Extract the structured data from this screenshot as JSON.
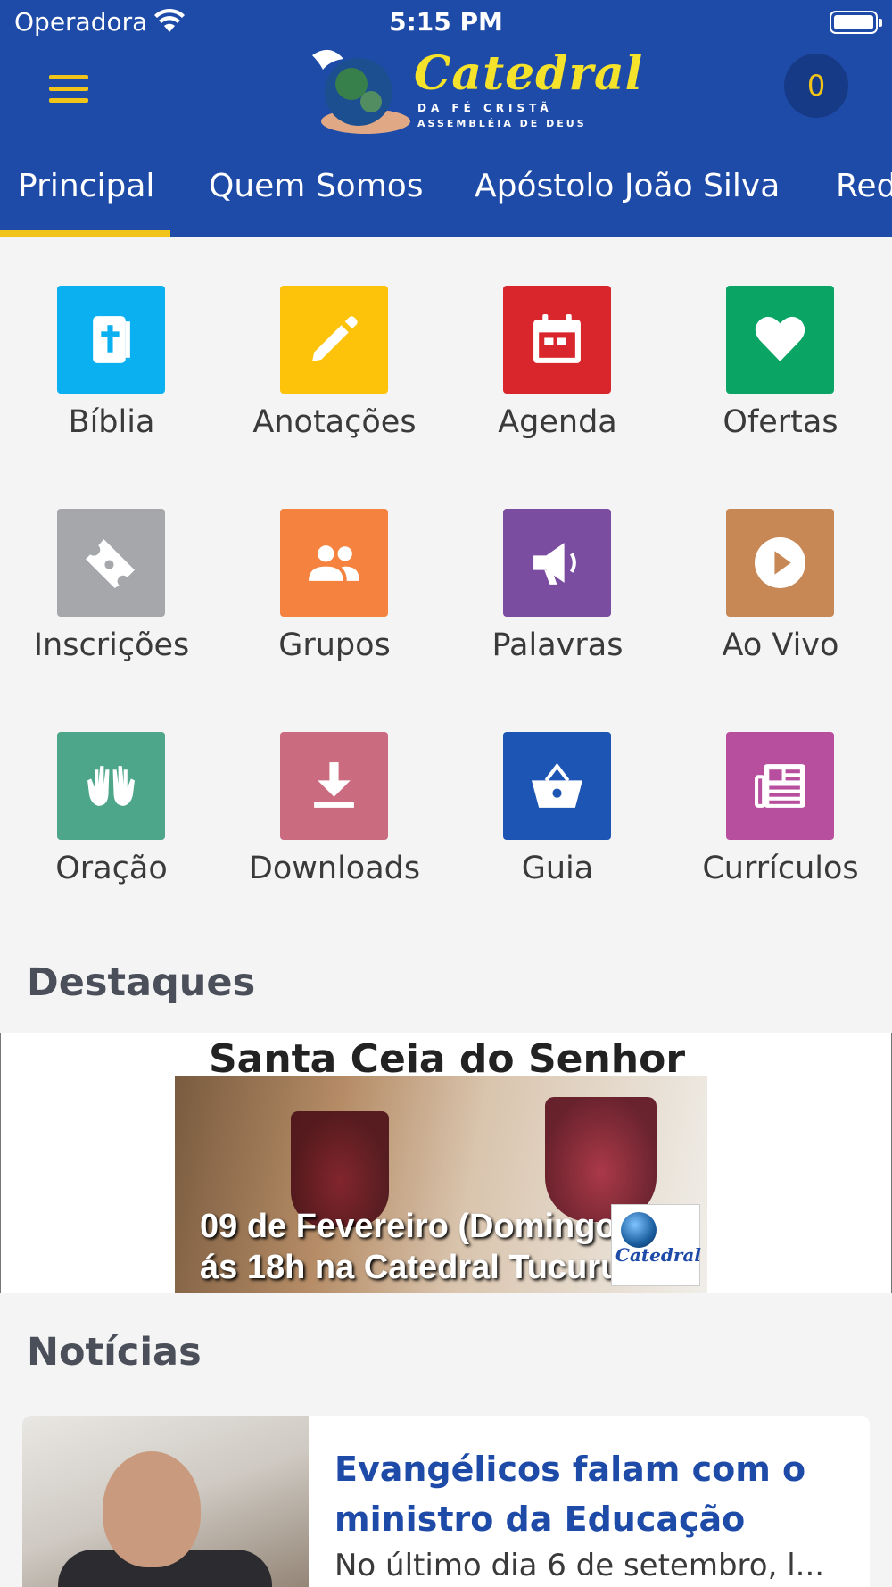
{
  "status_bar": {
    "carrier": "Operadora",
    "time": "5:15 PM"
  },
  "header": {
    "logo_text": "Catedral",
    "logo_sub1": "DA FÉ CRISTÃ",
    "logo_sub2": "ASSEMBLÉIA DE DEUS",
    "cart_count": "0"
  },
  "tabs": [
    {
      "label": "Principal",
      "active": true
    },
    {
      "label": "Quem Somos"
    },
    {
      "label": "Apóstolo João Silva"
    },
    {
      "label": "Red"
    }
  ],
  "tiles": [
    {
      "label": "Bíblia",
      "color": "#0ab0ef",
      "icon": "bible-icon"
    },
    {
      "label": "Anotações",
      "color": "#fdc30b",
      "icon": "pencil-icon"
    },
    {
      "label": "Agenda",
      "color": "#d9262c",
      "icon": "calendar-icon"
    },
    {
      "label": "Ofertas",
      "color": "#0aa564",
      "icon": "heart-icon"
    },
    {
      "label": "Inscrições",
      "color": "#a5a7aa",
      "icon": "ticket-icon"
    },
    {
      "label": "Grupos",
      "color": "#f5833f",
      "icon": "users-icon"
    },
    {
      "label": "Palavras",
      "color": "#7b4da0",
      "icon": "megaphone-icon"
    },
    {
      "label": "Ao Vivo",
      "color": "#c78856",
      "icon": "play-icon"
    },
    {
      "label": "Oração",
      "color": "#4da68a",
      "icon": "praying-hands-icon"
    },
    {
      "label": "Downloads",
      "color": "#cb6b80",
      "icon": "download-icon"
    },
    {
      "label": "Guia",
      "color": "#1d55b4",
      "icon": "basket-icon"
    },
    {
      "label": "Currículos",
      "color": "#b84f9e",
      "icon": "newspaper-icon"
    }
  ],
  "sections": {
    "highlights": "Destaques",
    "news": "Notícias"
  },
  "banner": {
    "title": "Santa Ceia do Senhor",
    "line1": "09 de Fevereiro (Domingo)",
    "line2": "ás 18h na Catedral Tucuruvi",
    "logo_text": "Catedral"
  },
  "news": [
    {
      "title": "Evangélicos falam com o ministro da Educação",
      "excerpt": "No último dia 6 de setembro, l..."
    }
  ],
  "colors": {
    "header_bg": "#1e4aa8",
    "accent": "#f0c419"
  }
}
